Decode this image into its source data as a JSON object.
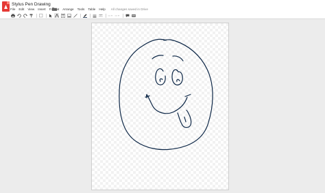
{
  "app": {
    "title": "Stylus Pen Drawing",
    "save_status": "All changes saved in Drive"
  },
  "menu": [
    "File",
    "Edit",
    "View",
    "Insert",
    "Format",
    "Arrange",
    "Tools",
    "Table",
    "Help"
  ],
  "toolbar": {
    "buttons": [
      "print-icon",
      "undo-icon",
      "redo-icon",
      "paint-format-icon",
      "zoom-icon",
      "select-icon",
      "shape-icon",
      "text-box-icon",
      "image-icon",
      "line-color-icon",
      "line-weight-icon",
      "line-dash-icon",
      "line-start-icon",
      "comment-icon",
      "more-icon"
    ]
  },
  "colors": {
    "logo": "#e53935",
    "stroke": "#0b2545",
    "canvas": "#ffffff",
    "workspace": "#ececec"
  }
}
